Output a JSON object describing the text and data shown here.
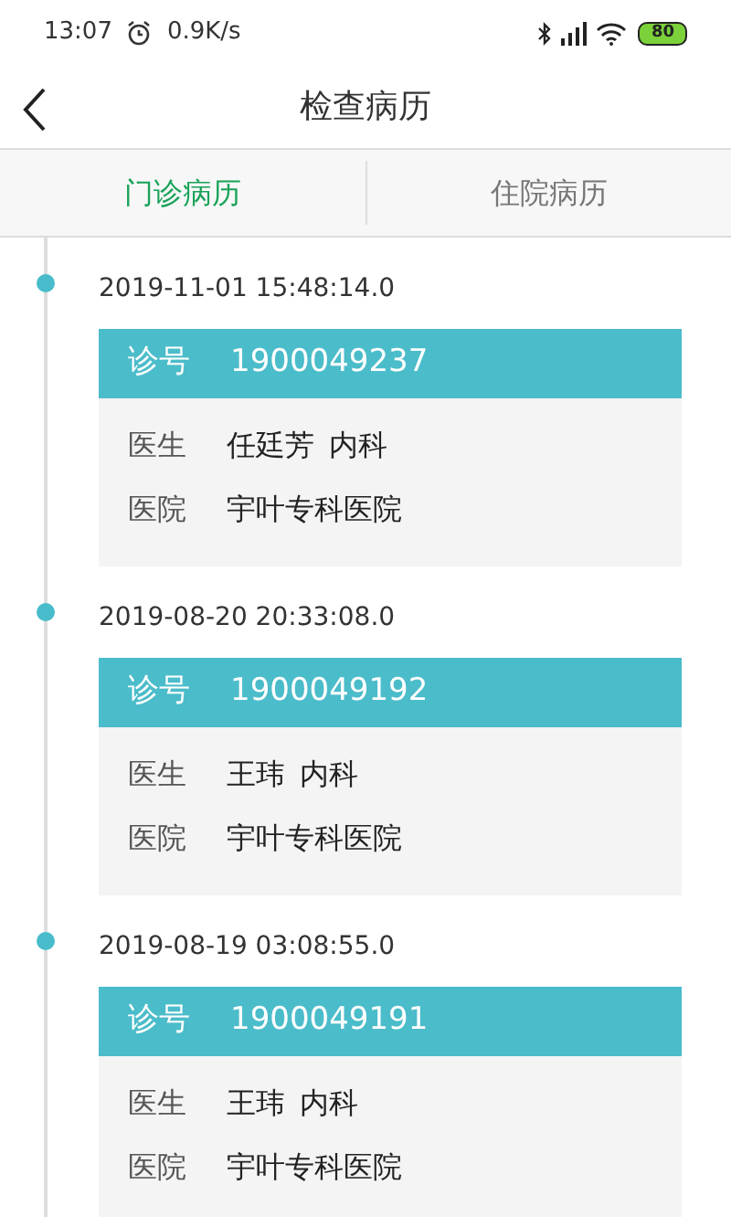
{
  "status_bar": {
    "time": "13:07",
    "speed": "0.9K/s",
    "battery": "80"
  },
  "header": {
    "title": "检查病历"
  },
  "tabs": [
    {
      "label": "门诊病历",
      "selected": true
    },
    {
      "label": "住院病历",
      "selected": false
    }
  ],
  "records": [
    {
      "datetime": "2019-11-01 15:48:14.0",
      "number_label": "诊号",
      "number": "1900049237",
      "doctor_label": "医生",
      "doctor": "任廷芳",
      "department": "内科",
      "hospital_label": "医院",
      "hospital": "宇叶专科医院"
    },
    {
      "datetime": "2019-08-20 20:33:08.0",
      "number_label": "诊号",
      "number": "1900049192",
      "doctor_label": "医生",
      "doctor": "王玮",
      "department": "内科",
      "hospital_label": "医院",
      "hospital": "宇叶专科医院"
    },
    {
      "datetime": "2019-08-19 03:08:55.0",
      "number_label": "诊号",
      "number": "1900049191",
      "doctor_label": "医生",
      "doctor": "王玮",
      "department": "内科",
      "hospital_label": "医院",
      "hospital": "宇叶专科医院"
    }
  ]
}
